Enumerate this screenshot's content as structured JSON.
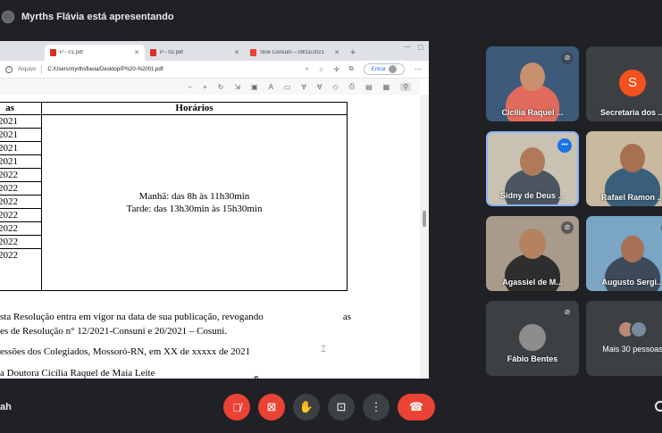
{
  "presenter": {
    "text": "Myrths Flávia está apresentando"
  },
  "browser": {
    "tabs": [
      {
        "title": "P - 01.pdf",
        "icon": "pdf-icon"
      },
      {
        "title": "P - 02.pdf",
        "icon": "pdf-icon"
      },
      {
        "title": "Sine Consuni – 09/11/2021",
        "icon": "gmail-icon"
      }
    ],
    "address_label": "Arquivo",
    "url": "C:/Users/myrthsflavia/Desktop/P%20-%2001.pdf",
    "signin_label": "Entrar"
  },
  "document": {
    "table_header_left": "as",
    "table_header_right": "Horários",
    "dates": [
      "2021",
      "2021",
      "2021",
      "2021",
      "2022",
      "2022",
      "2022",
      "2022",
      "2022",
      "2022",
      "2022"
    ],
    "times_line1": "Manhã: das 8h às 11h30min",
    "times_line2": "Tarde: das 13h30min às 15h30min",
    "para1_left": "sta Resolução entra em vigor na data de sua publicação, revogando",
    "para1_right": "as",
    "para2": "es de Resolução n° 12/2021-Consuni e 20/2021 – Cosuni.",
    "para3": "essões dos Colegiados, Mossoró-RN, em XX de xxxxx de 2021",
    "para4": "a Doutora Cicília Raquel de Maia Leite"
  },
  "participants": [
    {
      "name": "Cicília Raquel ...",
      "muted": true
    },
    {
      "name": "Secretaria dos ...",
      "initial": "S",
      "muted": false
    },
    {
      "name": "Sidny de Deus ...",
      "speaking": true
    },
    {
      "name": "Rafael Ramon ...",
      "muted": false
    },
    {
      "name": "Agassiel de M...",
      "muted": true
    },
    {
      "name": "Augusto Sergi...",
      "muted": true
    },
    {
      "name": "Fábio Bentes",
      "muted": true
    },
    {
      "name": "Mais 30 pessoas"
    }
  ],
  "bottom": {
    "meeting_name": "ah"
  },
  "colors": {
    "background": "#202124",
    "end_call": "#ea4335",
    "speaking": "#1a73e8",
    "avatar_s": "#f4511e"
  }
}
